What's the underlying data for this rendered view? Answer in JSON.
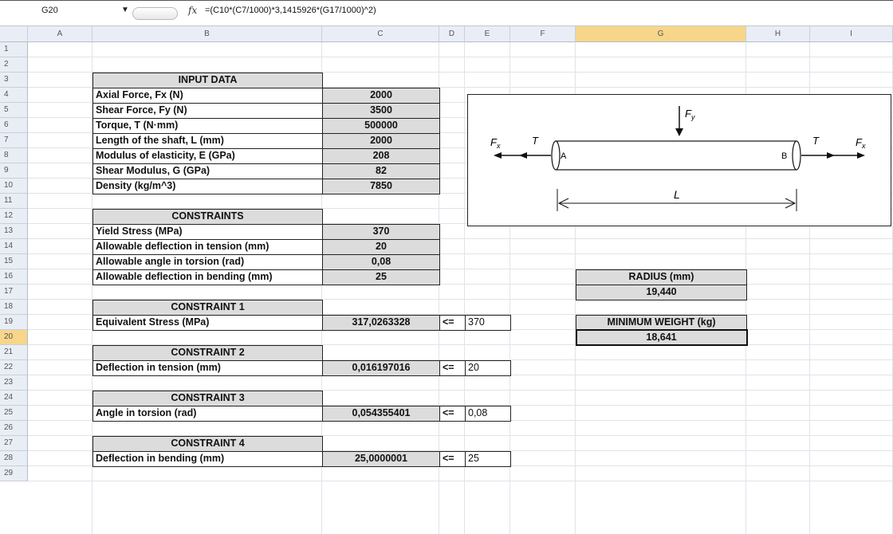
{
  "formula_bar": {
    "name_box": "G20",
    "fx_label": "fx",
    "formula": "=(C10*(C7/1000)*3,1415926*(G17/1000)^2)"
  },
  "columns": [
    "A",
    "B",
    "C",
    "D",
    "E",
    "F",
    "G",
    "H",
    "I"
  ],
  "rows": [
    "1",
    "2",
    "3",
    "4",
    "5",
    "6",
    "7",
    "8",
    "9",
    "10",
    "11",
    "12",
    "13",
    "14",
    "15",
    "16",
    "17",
    "18",
    "19",
    "20",
    "21",
    "22",
    "23",
    "24",
    "25",
    "26",
    "27",
    "28",
    "29"
  ],
  "input": {
    "header": "INPUT DATA",
    "items": [
      {
        "label": "Axial Force, Fx (N)",
        "value": "2000"
      },
      {
        "label": "Shear Force, Fy (N)",
        "value": "3500"
      },
      {
        "label": "Torque, T (N·mm)",
        "value": "500000"
      },
      {
        "label": "Length of the shaft, L (mm)",
        "value": "2000"
      },
      {
        "label": "Modulus of elasticity, E (GPa)",
        "value": "208"
      },
      {
        "label": "Shear Modulus, G (GPa)",
        "value": "82"
      },
      {
        "label": "Density (kg/m^3)",
        "value": "7850"
      }
    ]
  },
  "constraints": {
    "header": "CONSTRAINTS",
    "items": [
      {
        "label": "Yield Stress (MPa)",
        "value": "370"
      },
      {
        "label": "Allowable deflection in tension (mm)",
        "value": "20"
      },
      {
        "label": "Allowable angle in torsion (rad)",
        "value": "0,08"
      },
      {
        "label": "Allowable deflection in bending (mm)",
        "value": "25"
      }
    ]
  },
  "checks": [
    {
      "header": "CONSTRAINT 1",
      "label": "Equivalent Stress (MPa)",
      "value": "317,0263328",
      "op": "<=",
      "limit": "370"
    },
    {
      "header": "CONSTRAINT 2",
      "label": "Deflection in tension (mm)",
      "value": "0,016197016",
      "op": "<=",
      "limit": "20"
    },
    {
      "header": "CONSTRAINT 3",
      "label": "Angle in torsion (rad)",
      "value": "0,054355401",
      "op": "<=",
      "limit": "0,08"
    },
    {
      "header": "CONSTRAINT 4",
      "label": "Deflection in bending (mm)",
      "value": "25,0000001",
      "op": "<=",
      "limit": "25"
    }
  ],
  "results": {
    "radius_label": "RADIUS (mm)",
    "radius_value": "19,440",
    "weight_label": "MINIMUM WEIGHT (kg)",
    "weight_value": "18,641"
  },
  "diagram": {
    "fy": "F",
    "fy_sub": "y",
    "fx": "F",
    "fx_sub": "x",
    "t": "T",
    "a": "A",
    "b": "B",
    "l": "L"
  }
}
